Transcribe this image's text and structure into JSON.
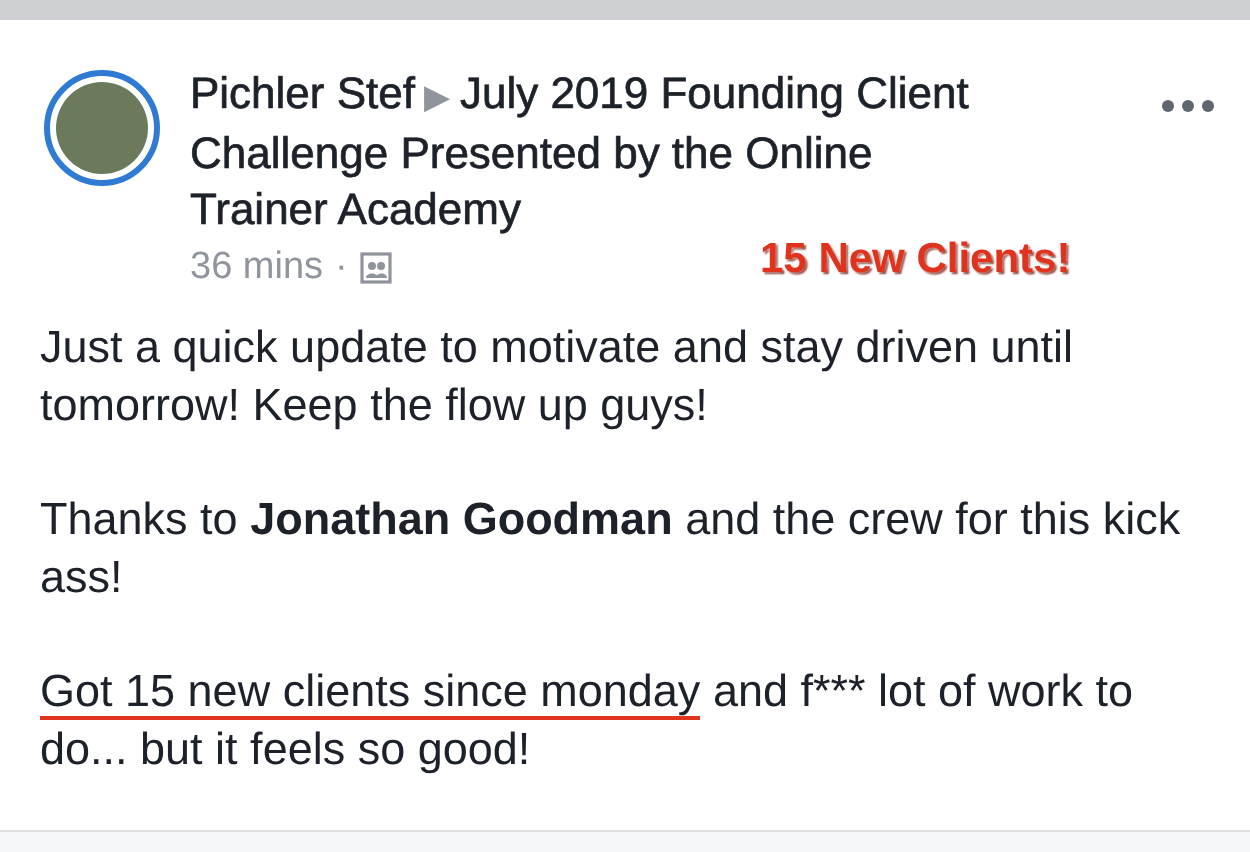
{
  "post": {
    "author": "Pichler Stef",
    "separator": "▶",
    "group": "July 2019 Founding Client Challenge Presented by the Online Trainer Academy",
    "time": "36 mins",
    "dot": "·",
    "annotation": "15 New Clients!",
    "paragraphs": [
      {
        "parts": [
          {
            "text": "Just a quick update to motivate and stay driven until tomorrow! Keep the flow up guys!",
            "underlined": false
          }
        ]
      },
      {
        "parts": [
          {
            "text": "Thanks to **Jonathan Goodman** and the crew for this kick ass!",
            "underlined": false
          }
        ]
      },
      {
        "parts": [
          {
            "text": "Got 15 new clients since monday",
            "underlined": true
          },
          {
            "text": " and f*** lot of work to do... but it feels so good!",
            "underlined": false
          }
        ]
      }
    ]
  }
}
